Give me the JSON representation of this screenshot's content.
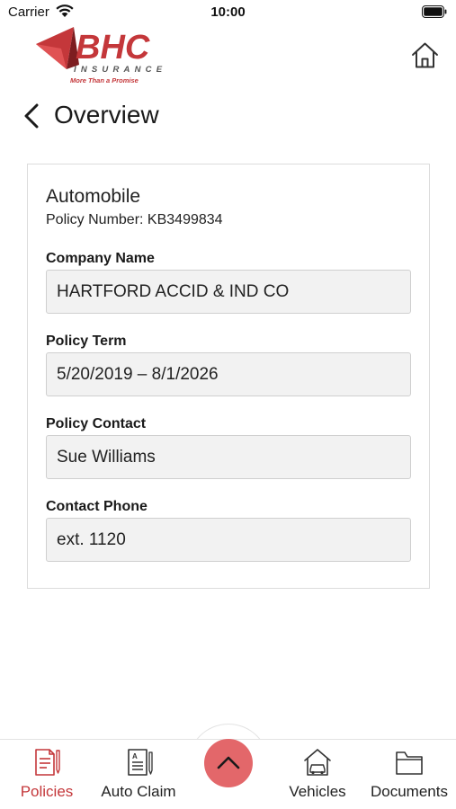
{
  "status_bar": {
    "carrier": "Carrier",
    "time": "10:00"
  },
  "header": {
    "logo": {
      "brand": "BHC",
      "subtitle": "INSURANCE",
      "tagline": "More Than a Promise"
    },
    "page_title": "Overview"
  },
  "policy": {
    "type": "Automobile",
    "number_text": "Policy Number: KB3499834",
    "fields": [
      {
        "label": "Company Name",
        "value": "HARTFORD ACCID & IND CO"
      },
      {
        "label": "Policy Term",
        "value": "5/20/2019 – 8/1/2026"
      },
      {
        "label": "Policy Contact",
        "value": "Sue Williams"
      },
      {
        "label": "Contact Phone",
        "value": "ext. 1120"
      }
    ]
  },
  "tab_bar": {
    "tabs": [
      {
        "label": "Policies",
        "icon": "policies-icon",
        "active": true
      },
      {
        "label": "Auto Claim",
        "icon": "auto-claim-icon",
        "active": false
      },
      {
        "label": "Vehicles",
        "icon": "vehicles-icon",
        "active": false
      },
      {
        "label": "Documents",
        "icon": "documents-icon",
        "active": false
      }
    ],
    "center_button_icon": "chevron-up-icon"
  },
  "colors": {
    "brand_red": "#c4373a",
    "fab": "#e3676a",
    "field_bg": "#f2f2f2",
    "active_tab": "#c4373a"
  }
}
